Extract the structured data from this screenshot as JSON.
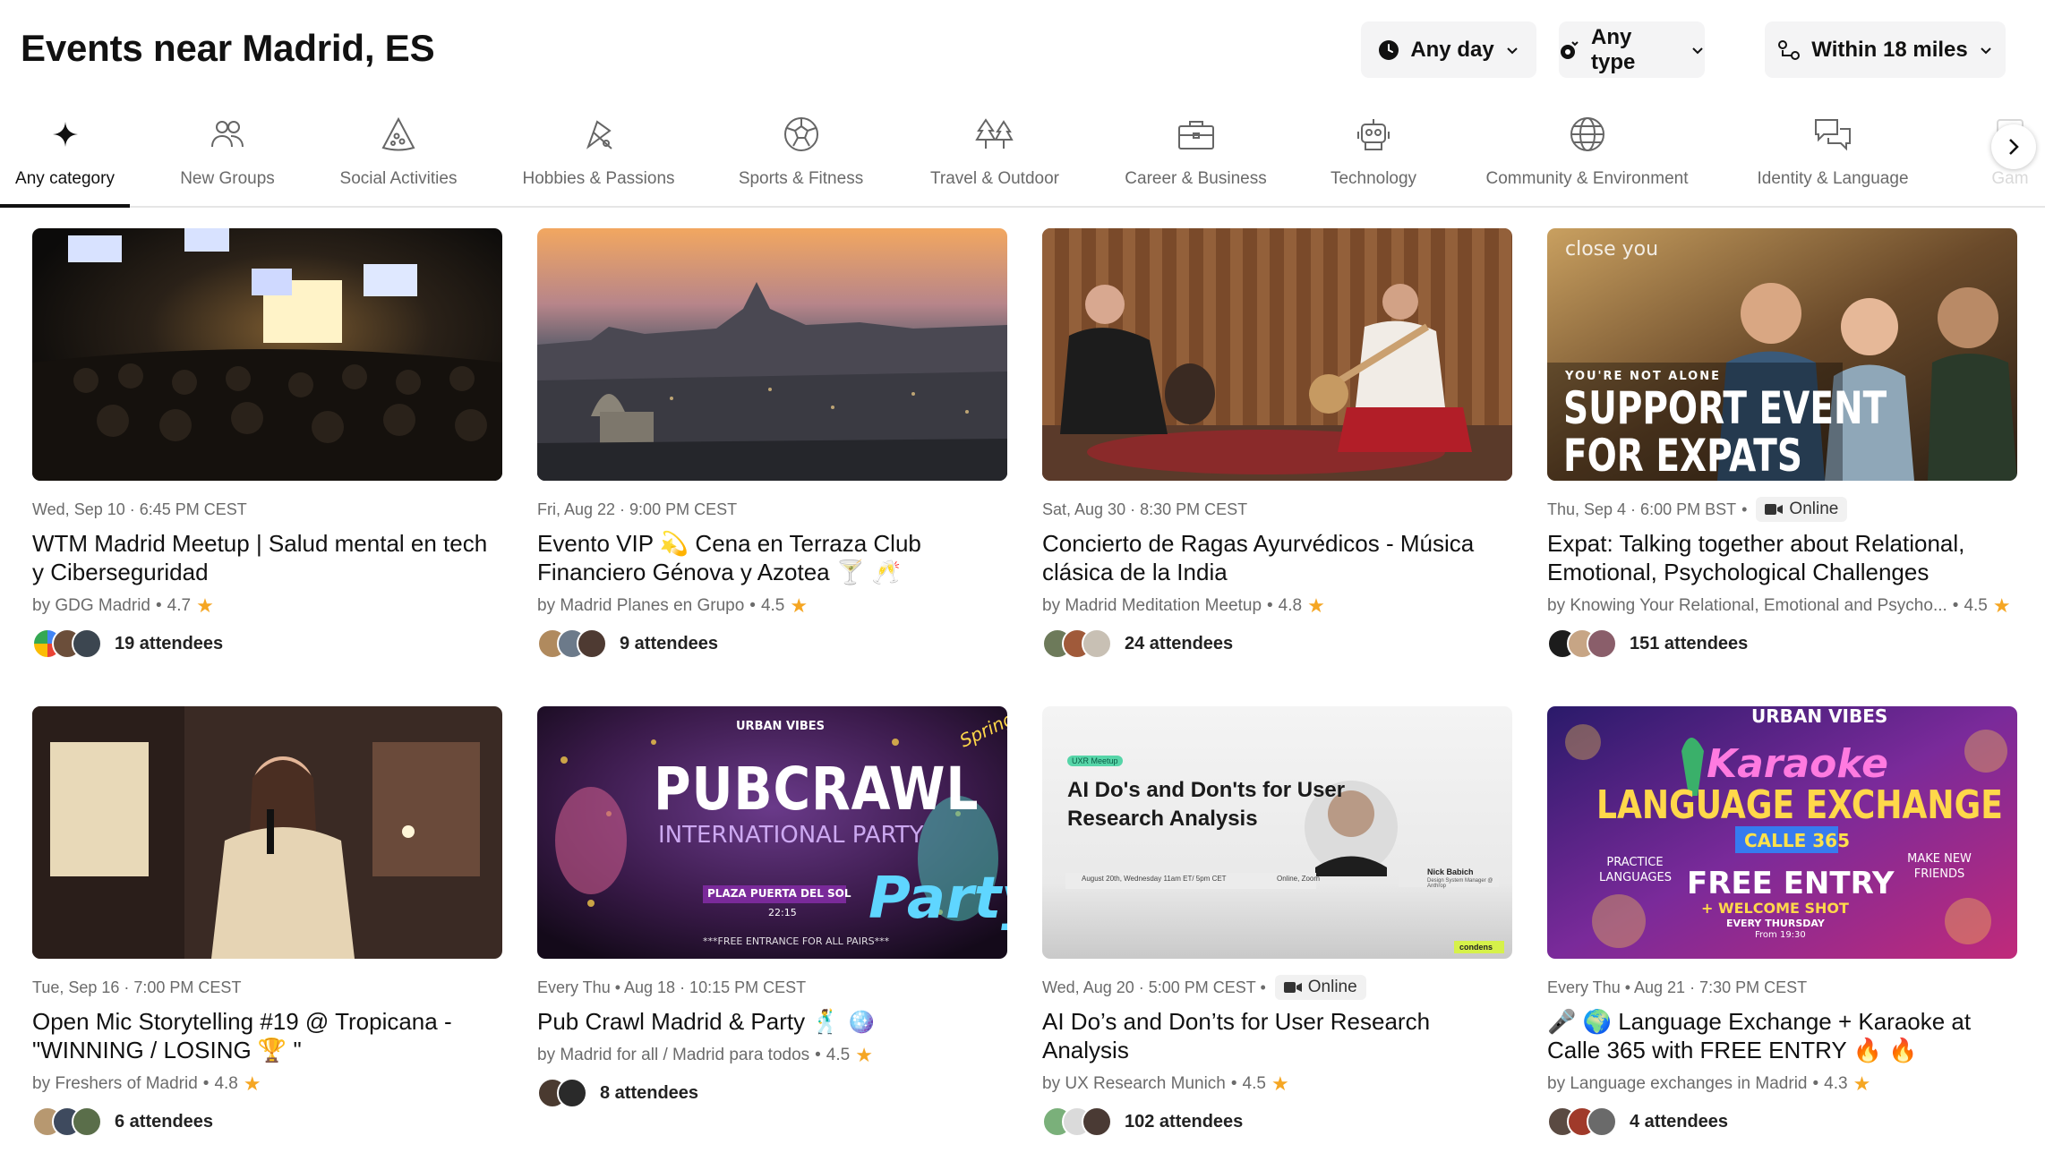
{
  "page": {
    "title": "Events near Madrid, ES"
  },
  "filters": {
    "day_label": "Any day",
    "type_label": "Any type",
    "distance_label": "Within 18 miles"
  },
  "categories": [
    {
      "label": "Any category",
      "icon": "sparkle-icon"
    },
    {
      "label": "New Groups",
      "icon": "people-icon"
    },
    {
      "label": "Social Activities",
      "icon": "pizza-slice-icon"
    },
    {
      "label": "Hobbies & Passions",
      "icon": "paint-palette-icon"
    },
    {
      "label": "Sports & Fitness",
      "icon": "soccer-ball-icon"
    },
    {
      "label": "Travel & Outdoor",
      "icon": "trees-icon"
    },
    {
      "label": "Career & Business",
      "icon": "briefcase-icon"
    },
    {
      "label": "Technology",
      "icon": "robot-icon"
    },
    {
      "label": "Community & Environment",
      "icon": "globe-icon"
    },
    {
      "label": "Identity & Language",
      "icon": "speech-bubbles-icon"
    },
    {
      "label": "Gam",
      "icon": "gaming-icon"
    }
  ],
  "events": [
    {
      "datetime": "Wed, Sep 10 · 6:45 PM CEST",
      "title": "WTM Madrid Meetup | Salud mental en tech y Ciberseguridad",
      "host": "by GDG Madrid",
      "rating": "4.7",
      "attendees": "19 attendees",
      "image": "conference-hall-photo"
    },
    {
      "datetime": "Fri, Aug 22 · 9:00 PM CEST",
      "title": "Evento VIP 💫 Cena en Terraza Club Financiero Génova y Azotea 🍸 🥂",
      "host": "by Madrid Planes en Grupo",
      "rating": "4.5",
      "attendees": "9 attendees",
      "image": "madrid-skyline-photo"
    },
    {
      "datetime": "Sat, Aug 30 · 8:30 PM CEST",
      "title": "Concierto de Ragas Ayurvédicos - Música clásica de la India",
      "host": "by Madrid Meditation Meetup",
      "rating": "4.8",
      "attendees": "24 attendees",
      "image": "sitar-concert-photo"
    },
    {
      "datetime": "Thu, Sep 4 · 6:00 PM BST",
      "online": "Online",
      "title": "Expat: Talking together about Relational, Emotional, Psychological Challenges",
      "host": "by Knowing Your Relational, Emotional and Psycho...",
      "rating": "4.5",
      "attendees": "151 attendees",
      "image": "support-event-banner",
      "overlay": {
        "brand": "close you",
        "kicker": "YOU'RE NOT ALONE",
        "line1": "SUPPORT EVENT",
        "line2": "FOR EXPATS"
      }
    },
    {
      "datetime": "Tue, Sep 16 · 7:00 PM CEST",
      "title": "Open Mic Storytelling #19 @ Tropicana - \"WINNING / LOSING 🏆 \"",
      "host": "by Freshers of Madrid",
      "rating": "4.8",
      "attendees": "6 attendees",
      "image": "open-mic-photo"
    },
    {
      "datetime": "Every Thu • Aug 18 · 10:15 PM CEST",
      "title": "Pub Crawl Madrid & Party 🕺 🪩",
      "host": "by Madrid for all / Madrid para todos",
      "rating": "4.5",
      "attendees": "8 attendees",
      "image": "pub-crawl-poster",
      "overlay": {
        "brand": "URBAN VIBES",
        "line1": "PUBCRAWL",
        "line2": "INTERNATIONAL PARTY",
        "place": "PLAZA PUERTA DEL SOL",
        "time": "22:15",
        "footer": "***FREE ENTRANCE FOR ALL PAIRS***",
        "script": "Party",
        "corner": "Spring"
      }
    },
    {
      "datetime": "Wed, Aug 20 · 5:00 PM CEST •",
      "online": "Online",
      "title": "AI Do’s and Don’ts for User Research Analysis",
      "host": "by UX Research Munich",
      "rating": "4.5",
      "attendees": "102 attendees",
      "image": "webinar-banner",
      "overlay": {
        "tag": "UXR Meetup",
        "line1": "AI Do's and Don'ts for User",
        "line2": "Research Analysis",
        "when": "August 20th, Wednesday 11am ET/ 5pm CET",
        "where": "Online, Zoom",
        "speaker": "Nick Babich",
        "role": "Design System Manager @ Anthrop",
        "sponsor": "condens"
      }
    },
    {
      "datetime": "Every Thu • Aug 21 · 7:30 PM CEST",
      "title": "🎤 🌍 Language Exchange + Karaoke at Calle 365 with FREE ENTRY 🔥 🔥",
      "host": "by Language exchanges in Madrid",
      "rating": "4.3",
      "attendees": "4 attendees",
      "image": "karaoke-poster",
      "overlay": {
        "brand": "URBAN VIBES",
        "script": "Karaoke",
        "line1": "LANGUAGE EXCHANGE",
        "venue": "CALLE 365",
        "left": "PRACTICE LANGUAGES",
        "right": "MAKE NEW FRIENDS",
        "free": "FREE ENTRY",
        "shot": "+ WELCOME SHOT",
        "when": "EVERY THURSDAY",
        "from": "From 19:30"
      }
    }
  ],
  "colors": {
    "accent": "#111111",
    "star": "#f5a623",
    "muted": "#6b6b6b",
    "pill": "#f4f4f5"
  }
}
